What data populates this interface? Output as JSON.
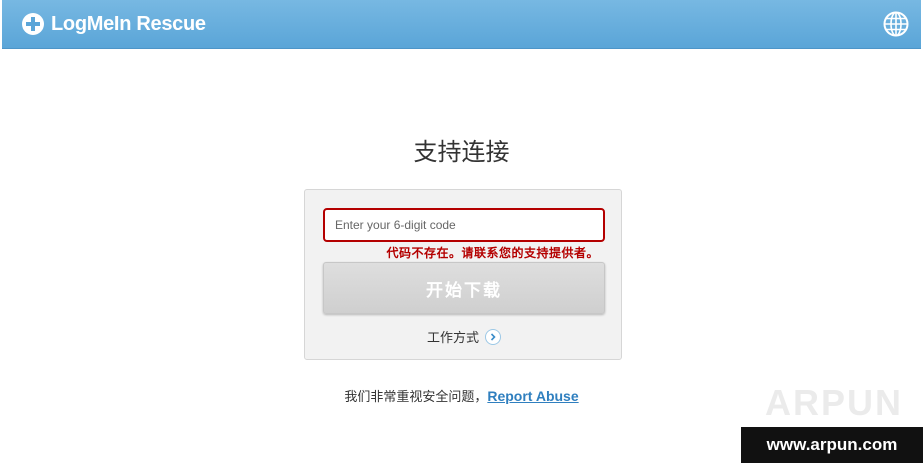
{
  "header": {
    "brand": "LogMeIn Rescue",
    "brand_icon": "plus-circle-icon",
    "language_icon": "globe-icon",
    "bar_color": "#5aa5d8"
  },
  "main": {
    "title": "支持连接",
    "code_input": {
      "value": "",
      "placeholder": "Enter your 6-digit code"
    },
    "error": "代码不存在。请联系您的支持提供者。",
    "download_button": "开始下载",
    "how_it_works": "工作方式",
    "error_color": "#b40000"
  },
  "footer": {
    "text": "我们非常重视安全问题，",
    "report_link": "Report Abuse"
  },
  "watermark": {
    "logo": "ARPUN",
    "url": "www.arpun.com"
  }
}
